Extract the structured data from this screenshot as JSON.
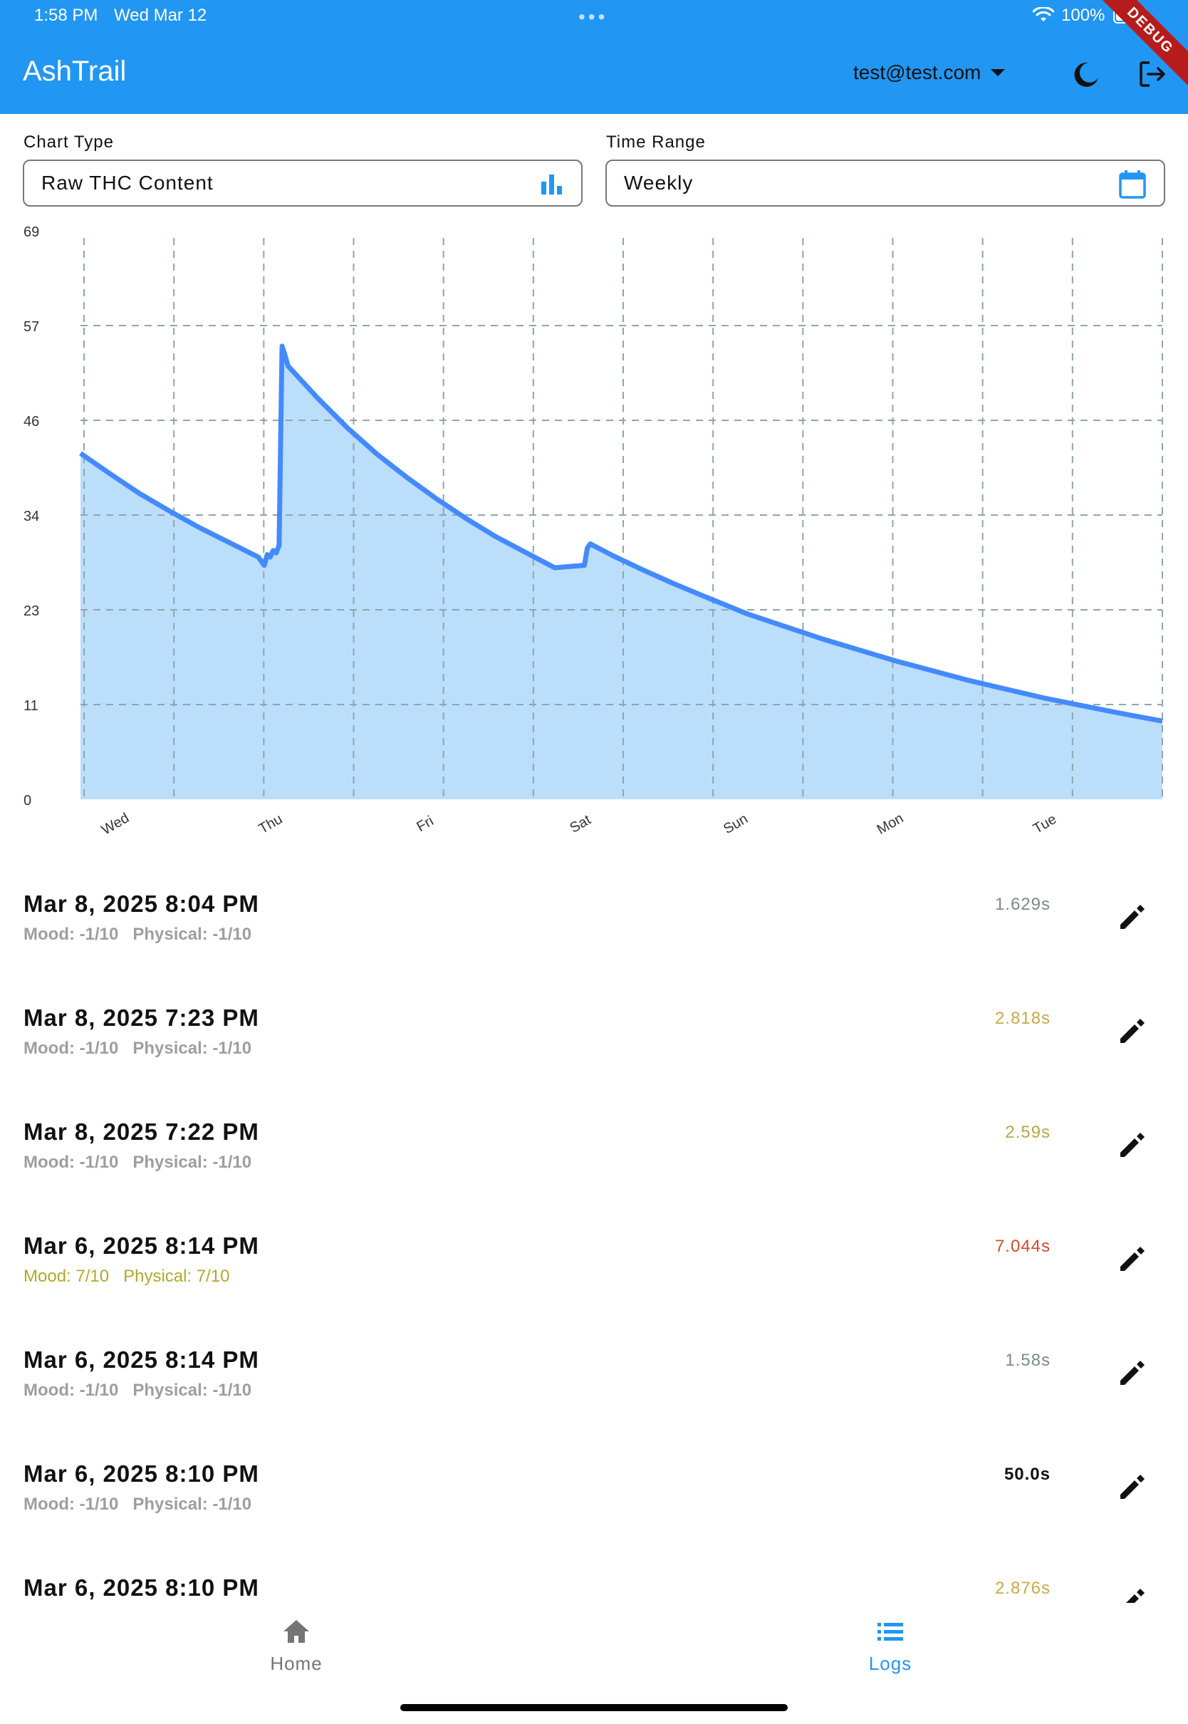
{
  "status_bar": {
    "time": "1:58 PM",
    "date": "Wed Mar 12",
    "battery": "100%",
    "debug_label": "DEBUG"
  },
  "app_bar": {
    "title": "AshTrail",
    "account": "test@test.com",
    "theme_icon": "moon-icon",
    "logout_icon": "logout-icon"
  },
  "controls": {
    "chart_type_label": "Chart Type",
    "chart_type_value": "Raw THC Content",
    "chart_type_icon": "bar-chart-icon",
    "time_range_label": "Time Range",
    "time_range_value": "Weekly",
    "time_range_icon": "calendar-icon"
  },
  "chart_data": {
    "type": "area",
    "title": "",
    "xlabel": "",
    "ylabel": "",
    "ylim": [
      0,
      69
    ],
    "y_ticks": [
      "0",
      "11",
      "23",
      "34",
      "46",
      "57",
      "69"
    ],
    "x_ticks": [
      "Wed",
      "Thu",
      "Fri",
      "Sat",
      "Sun",
      "Mon",
      "Tue"
    ],
    "x_range_days": [
      0,
      7.3
    ],
    "grid": true,
    "colors": {
      "line": "#448aff",
      "fill": "#bbdefb",
      "grid": "#90a4ae"
    },
    "series": [
      {
        "values_x_days": [
          0,
          0.2,
          0.4,
          0.6,
          0.8,
          1.0,
          1.2,
          1.24,
          1.26,
          1.28,
          1.3,
          1.32,
          1.34,
          1.36,
          1.38,
          1.4,
          1.6,
          1.8,
          2.0,
          2.2,
          2.4,
          2.6,
          2.8,
          3.0,
          3.2,
          3.4,
          3.42,
          3.44,
          3.6,
          3.8,
          4.0,
          4.2,
          4.5,
          5.0,
          5.5,
          6.0,
          6.5,
          7.0,
          7.3
        ],
        "values_y": [
          42,
          39.5,
          37.1,
          35,
          33,
          31.2,
          29.4,
          28.4,
          29.7,
          29.4,
          30.2,
          29.9,
          30.8,
          55,
          53.9,
          52.6,
          48.7,
          45.1,
          41.9,
          39.1,
          36.5,
          34.1,
          31.9,
          30.0,
          28.1,
          28.4,
          30.5,
          31,
          29.5,
          27.8,
          26.2,
          24.7,
          22.5,
          19.5,
          16.8,
          14.4,
          12.3,
          10.5,
          9.5
        ]
      }
    ]
  },
  "logs": [
    {
      "date": "Mar 8, 2025 8:04 PM",
      "mood": "Mood: -1/10",
      "physical": "Physical: -1/10",
      "duration": "1.629s",
      "duration_color": "#7e8a87",
      "sub_color": "#9e9e9e"
    },
    {
      "date": "Mar 8, 2025 7:23 PM",
      "mood": "Mood: -1/10",
      "physical": "Physical: -1/10",
      "duration": "2.818s",
      "duration_color": "#c9a84b",
      "sub_color": "#9e9e9e"
    },
    {
      "date": "Mar 8, 2025 7:22 PM",
      "mood": "Mood: -1/10",
      "physical": "Physical: -1/10",
      "duration": "2.59s",
      "duration_color": "#b8a548",
      "sub_color": "#9e9e9e"
    },
    {
      "date": "Mar 6, 2025 8:14 PM",
      "mood": "Mood: 7/10",
      "physical": "Physical: 7/10",
      "duration": "7.044s",
      "duration_color": "#d24a2c",
      "sub_color": "#b5a72a"
    },
    {
      "date": "Mar 6, 2025 8:14 PM",
      "mood": "Mood: -1/10",
      "physical": "Physical: -1/10",
      "duration": "1.58s",
      "duration_color": "#7e8a87",
      "sub_color": "#9e9e9e"
    },
    {
      "date": "Mar 6, 2025 8:10 PM",
      "mood": "Mood: -1/10",
      "physical": "Physical: -1/10",
      "duration": "50.0s",
      "duration_color": "#111111",
      "sub_color": "#9e9e9e"
    },
    {
      "date": "Mar 6, 2025 8:10 PM",
      "mood": "",
      "physical": "",
      "duration": "2.876s",
      "duration_color": "#c9a84b",
      "sub_color": "#9e9e9e"
    }
  ],
  "bottom_nav": {
    "home_label": "Home",
    "logs_label": "Logs",
    "active": "Logs"
  }
}
